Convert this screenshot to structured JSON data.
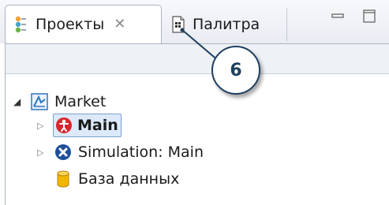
{
  "tabs": [
    {
      "label": "Проекты",
      "icon": "projects-icon",
      "active": true,
      "close_glyph": "✕"
    },
    {
      "label": "Палитра",
      "icon": "palette-icon",
      "active": false
    }
  ],
  "window_controls": [
    "minimize-icon",
    "maximize-icon"
  ],
  "tree": {
    "root": {
      "label": "Market",
      "icon": "model-icon",
      "expanded": true
    },
    "children": [
      {
        "label": "Main",
        "icon": "agent-icon",
        "selected": true,
        "expander": "collapsed"
      },
      {
        "label": "Simulation: Main",
        "icon": "simulation-icon",
        "selected": false,
        "expander": "collapsed"
      },
      {
        "label": "База данных",
        "icon": "database-icon",
        "selected": false,
        "expander": "none"
      }
    ]
  },
  "callout": {
    "number": "6"
  },
  "colors": {
    "selection_bg": "#dbe9fb",
    "selection_border": "#7da2ce",
    "agent_red": "#d9272e",
    "simulation_blue": "#1f4f9b",
    "database_yellow": "#f2b500",
    "callout_stroke": "#1f3f5f"
  }
}
